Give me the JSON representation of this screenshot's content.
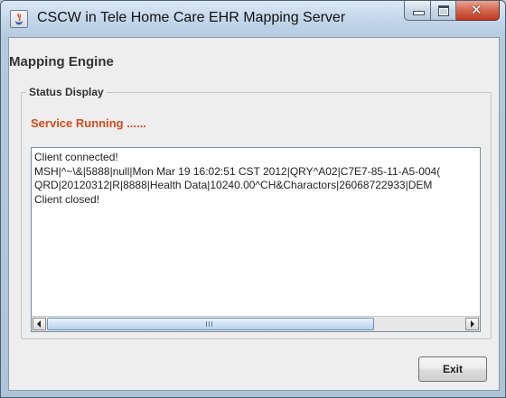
{
  "window": {
    "title": "CSCW in Tele Home Care EHR Mapping Server",
    "icon": "java-app-icon"
  },
  "panel": {
    "title": "Mapping Engine"
  },
  "status_group": {
    "legend": "Status Display",
    "status_text": "Service Running ......",
    "status_color": "#d24b1e"
  },
  "log": {
    "lines": [
      "Client connected!",
      "MSH|^~\\&|5888|null|Mon Mar 19 16:02:51 CST 2012|QRY^A02|C7E7-85-11-A5-004(",
      "QRD|20120312|R|8888|Health Data|10240.00^CH&Charactors|26068722933|DEM",
      "Client closed!"
    ],
    "horizontal_scroll_position": 0
  },
  "actions": {
    "exit_label": "Exit"
  }
}
